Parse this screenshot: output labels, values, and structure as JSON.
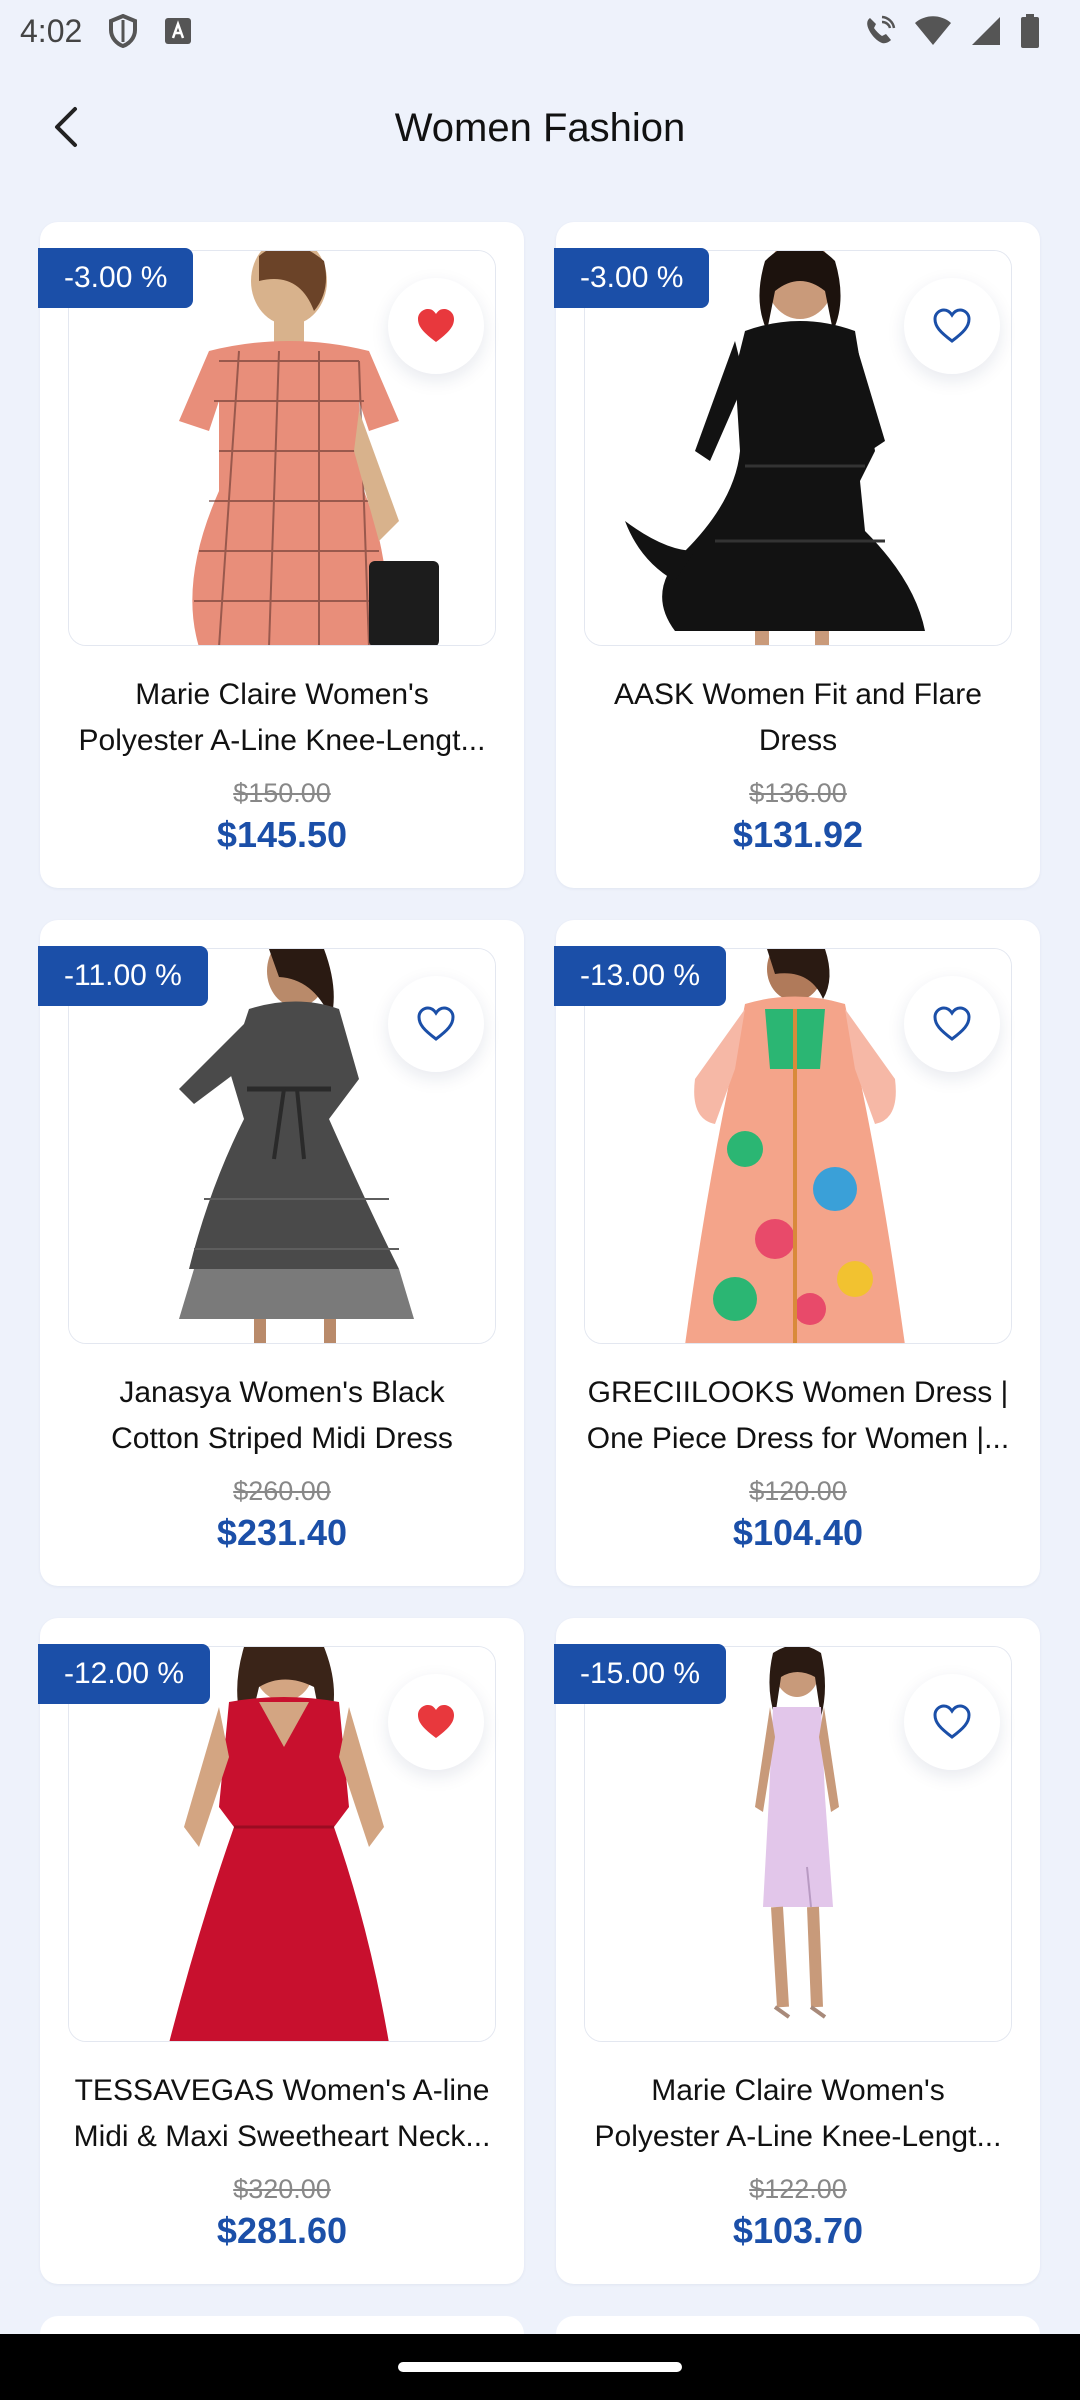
{
  "status_bar": {
    "time": "4:02"
  },
  "header": {
    "title": "Women Fashion"
  },
  "products": [
    {
      "discount": "-3.00 %",
      "name_line1": "Marie Claire Women's",
      "name_line2": "Polyester A-Line Knee-Lengt...",
      "old_price": "$150.00",
      "price": "$145.50",
      "favorite": true,
      "image": "pink-checked-dress"
    },
    {
      "discount": "-3.00 %",
      "name_line1": "AASK Women Fit and Flare",
      "name_line2": "Dress",
      "old_price": "$136.00",
      "price": "$131.92",
      "favorite": false,
      "image": "black-tiered-dress"
    },
    {
      "discount": "-11.00 %",
      "name_line1": "Janasya Women's Black",
      "name_line2": "Cotton Striped Midi Dress",
      "old_price": "$260.00",
      "price": "$231.40",
      "favorite": false,
      "image": "grey-midi-dress"
    },
    {
      "discount": "-13.00 %",
      "name_line1": "GRECIILOOKS Women Dress |",
      "name_line2": "One Piece Dress for Women |...",
      "old_price": "$120.00",
      "price": "$104.40",
      "favorite": false,
      "image": "floral-maxi-dress"
    },
    {
      "discount": "-12.00 %",
      "name_line1": "TESSAVEGAS Women's A-line",
      "name_line2": "Midi & Maxi Sweetheart Neck...",
      "old_price": "$320.00",
      "price": "$281.60",
      "favorite": true,
      "image": "red-sleeveless-dress"
    },
    {
      "discount": "-15.00 %",
      "name_line1": "Marie Claire Women's",
      "name_line2": "Polyester A-Line Knee-Lengt...",
      "old_price": "$122.00",
      "price": "$103.70",
      "favorite": false,
      "image": "lavender-sheath-dress"
    }
  ],
  "colors": {
    "accent": "#1b4fa8",
    "favorite_active": "#e8383d",
    "background": "#eef2fb"
  }
}
